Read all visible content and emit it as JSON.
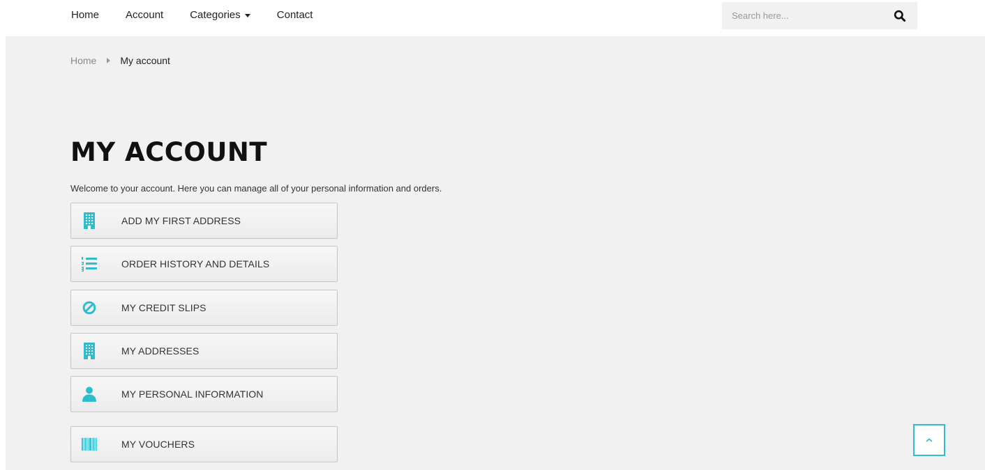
{
  "colors": {
    "accent": "#2fbccf",
    "background": "#f1f1f1",
    "title": "#111111"
  },
  "nav": {
    "home": "Home",
    "account": "Account",
    "categories": "Categories",
    "contact": "Contact"
  },
  "search": {
    "placeholder": "Search here...",
    "icon": "search-icon"
  },
  "breadcrumb": {
    "home": "Home",
    "current": "My account"
  },
  "page": {
    "title": "MY ACCOUNT",
    "welcome": "Welcome to your account. Here you can manage all of your personal information and orders."
  },
  "links": [
    {
      "label": "ADD MY FIRST ADDRESS",
      "icon": "building-icon"
    },
    {
      "label": "ORDER HISTORY AND DETAILS",
      "icon": "numbered-list-icon"
    },
    {
      "label": "MY CREDIT SLIPS",
      "icon": "ban-icon"
    },
    {
      "label": "MY ADDRESSES",
      "icon": "building-icon"
    },
    {
      "label": "MY PERSONAL INFORMATION",
      "icon": "user-icon"
    },
    {
      "label": "MY VOUCHERS",
      "icon": "barcode-icon"
    }
  ],
  "back_to_top": {
    "icon": "chevron-up-icon"
  }
}
